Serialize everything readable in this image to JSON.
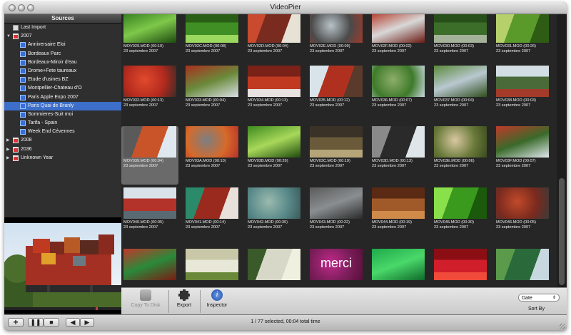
{
  "window": {
    "title": "VideoPier"
  },
  "sidebar": {
    "header": "Sources",
    "items": [
      {
        "label": "Last Import",
        "level": 0,
        "icon": "import-icon",
        "disclosure": ""
      },
      {
        "label": "2007",
        "level": 0,
        "icon": "calendar-folder-icon",
        "disclosure": "▼"
      },
      {
        "label": "Anniversaire Eloi",
        "level": 1,
        "icon": "film-icon",
        "disclosure": ""
      },
      {
        "label": "Bordeaux Parc",
        "level": 1,
        "icon": "film-icon",
        "disclosure": ""
      },
      {
        "label": "Bordeaux-Miroir d'eau",
        "level": 1,
        "icon": "film-icon",
        "disclosure": ""
      },
      {
        "label": "Drome+Fete taureaux",
        "level": 1,
        "icon": "film-icon",
        "disclosure": ""
      },
      {
        "label": "Etude d'usines BZ",
        "level": 1,
        "icon": "film-icon",
        "disclosure": ""
      },
      {
        "label": "Montpellier-Chateau d'O",
        "level": 1,
        "icon": "film-icon",
        "disclosure": ""
      },
      {
        "label": "Paris Apple Expo 2007",
        "level": 1,
        "icon": "film-icon",
        "disclosure": ""
      },
      {
        "label": "Paris Quai de Branly",
        "level": 1,
        "icon": "film-icon",
        "disclosure": "",
        "selected": true
      },
      {
        "label": "Sommieres-Suit moi",
        "level": 1,
        "icon": "film-icon",
        "disclosure": ""
      },
      {
        "label": "Tarifa - Spain",
        "level": 1,
        "icon": "film-icon",
        "disclosure": ""
      },
      {
        "label": "Week End Cévennes",
        "level": 1,
        "icon": "film-icon",
        "disclosure": ""
      },
      {
        "label": "2008",
        "level": 0,
        "icon": "calendar-folder-icon",
        "disclosure": "▶"
      },
      {
        "label": "2036",
        "level": 0,
        "icon": "calendar-folder-icon",
        "disclosure": "▶"
      },
      {
        "label": "Unknown Year",
        "level": 0,
        "icon": "calendar-folder-icon",
        "disclosure": "▶"
      }
    ]
  },
  "clips": [
    {
      "name": "MOV029.MOD (00:10)",
      "date": "23 septembre 2007",
      "palette": [
        "#2f7a1c",
        "#7ec84a",
        "#1d4a10"
      ]
    },
    {
      "name": "MOV02C.MOD (00:08)",
      "date": "23 septembre 2007",
      "palette": [
        "#3f8f24",
        "#9ad85e",
        "#2a5d16"
      ]
    },
    {
      "name": "MOV02D.MOD (00:04)",
      "date": "23 septembre 2007",
      "palette": [
        "#7a2b20",
        "#c94a2e",
        "#e8e2d6"
      ]
    },
    {
      "name": "MOV02E.MOD (00:09)",
      "date": "23 septembre 2007",
      "palette": [
        "#4a4a4a",
        "#b8c3c8",
        "#9e3a2a"
      ]
    },
    {
      "name": "MOV02F.MOD (00:02)",
      "date": "23 septembre 2007",
      "palette": [
        "#b3321f",
        "#d8d8d8",
        "#6b1a12"
      ]
    },
    {
      "name": "MOV030.MOD (00:03)",
      "date": "23 septembre 2007",
      "palette": [
        "#3c6e2a",
        "#a5b29a",
        "#274f1a"
      ]
    },
    {
      "name": "MOV031.MOD (00:26)",
      "date": "23 septembre 2007",
      "palette": [
        "#5a9a2a",
        "#b6d16c",
        "#2e5c14"
      ]
    },
    {
      "name": "MOV032.MOD (00:13)",
      "date": "23 septembre 2007",
      "palette": [
        "#b32a1e",
        "#e24a2c",
        "#3a2b25"
      ]
    },
    {
      "name": "MOV033.MOD (00:04)",
      "date": "23 septembre 2007",
      "palette": [
        "#a8301e",
        "#6a8a3a",
        "#d9dfe6"
      ]
    },
    {
      "name": "MOV034.MOD (00:13)",
      "date": "23 septembre 2007",
      "palette": [
        "#c03a22",
        "#e8e2e0",
        "#7a2218"
      ]
    },
    {
      "name": "MOV035.MOD (00:12)",
      "date": "23 septembre 2007",
      "palette": [
        "#b0301f",
        "#d9e4ea",
        "#5a3a2a"
      ]
    },
    {
      "name": "MOV036.MOD (00:07)",
      "date": "23 septembre 2007",
      "palette": [
        "#3e7a2a",
        "#8eae6a",
        "#c8d8e0"
      ]
    },
    {
      "name": "MOV037.MOD (00:04)",
      "date": "23 septembre 2007",
      "palette": [
        "#5b8a3a",
        "#b9c8d0",
        "#2f4e1c"
      ]
    },
    {
      "name": "MOV038.MOD (00:03)",
      "date": "23 septembre 2007",
      "palette": [
        "#4b6a3a",
        "#a33a2a",
        "#d2dde4"
      ]
    },
    {
      "name": "MOV039.MOD (00:04)",
      "date": "23 septembre 2007",
      "palette": [
        "#c9542a",
        "#5a5a5a",
        "#dfe8ee"
      ]
    },
    {
      "name": "MOV03A.MOD (00:10)",
      "date": "23 septembre 2007",
      "palette": [
        "#d66a2a",
        "#7b7f82",
        "#b8322a"
      ]
    },
    {
      "name": "MOV03B.MOD (00:26)",
      "date": "23 septembre 2007",
      "palette": [
        "#3d8a1e",
        "#a8d85a",
        "#1e4a0e"
      ]
    },
    {
      "name": "MOV03C.MOD (00:19)",
      "date": "23 septembre 2007",
      "palette": [
        "#6a5a3a",
        "#b7a57a",
        "#3a3226"
      ]
    },
    {
      "name": "MOV03D.MOD (00:13)",
      "date": "23 septembre 2007",
      "palette": [
        "#2a2a2a",
        "#8a8a8a",
        "#dfe6ea"
      ]
    },
    {
      "name": "MOV03E.MOD (00:06)",
      "date": "23 septembre 2007",
      "palette": [
        "#6a7a3a",
        "#d8c8a0",
        "#3a4a1e"
      ]
    },
    {
      "name": "MOV03F.MOD (00:07)",
      "date": "23 septembre 2007",
      "palette": [
        "#c0392b",
        "#3a6a2a",
        "#e0e8ee"
      ]
    },
    {
      "name": "MOV040.MOD (00:05)",
      "date": "23 septembre 2007",
      "palette": [
        "#b3322a",
        "#5a6a72",
        "#d8e2e8"
      ]
    },
    {
      "name": "MOV041.MOD (00:14)",
      "date": "23 septembre 2007",
      "palette": [
        "#9a2a1e",
        "#2a8a6a",
        "#e8e0da"
      ]
    },
    {
      "name": "MOV042.MOD (00:30)",
      "date": "23 septembre 2007",
      "palette": [
        "#5a8a8a",
        "#9abaae",
        "#3a5a5a"
      ]
    },
    {
      "name": "MOV043.MOD (00:22)",
      "date": "23 septembre 2007",
      "palette": [
        "#5a5a5a",
        "#8a8e90",
        "#2a2a2a"
      ]
    },
    {
      "name": "MOV044.MOD (00:19)",
      "date": "23 septembre 2007",
      "palette": [
        "#a05a2a",
        "#d08a4a",
        "#5a2a14"
      ]
    },
    {
      "name": "MOV045.MOD (00:30)",
      "date": "23 septembre 2007",
      "palette": [
        "#3a9a1e",
        "#8ae04a",
        "#1a5a0a"
      ]
    },
    {
      "name": "MOV046.MOD (00:05)",
      "date": "23 septembre 2007",
      "palette": [
        "#7a2a1e",
        "#c04a2a",
        "#3a3a3a"
      ]
    },
    {
      "name": "",
      "date": "",
      "palette": [
        "#c0392b",
        "#2a8a3a",
        "#7a1a14"
      ]
    },
    {
      "name": "",
      "date": "",
      "palette": [
        "#e8e8d8",
        "#6a8a3a",
        "#c8c8a8"
      ]
    },
    {
      "name": "",
      "date": "",
      "palette": [
        "#d8d8c8",
        "#3a5a2a",
        "#f0f0e0"
      ]
    },
    {
      "name": "",
      "date": "",
      "palette": [
        "#7a1e5a",
        "#c02a8a",
        "#5a0e3a"
      ],
      "text": "merci"
    },
    {
      "name": "",
      "date": "",
      "palette": [
        "#1eaa4a",
        "#4ad86a",
        "#0e6a2a"
      ]
    },
    {
      "name": "",
      "date": "",
      "palette": [
        "#d01e2a",
        "#f04a3a",
        "#8a0e14"
      ]
    },
    {
      "name": "",
      "date": "",
      "palette": [
        "#2a6a3a",
        "#5a9a4a",
        "#c8d8e0"
      ]
    }
  ],
  "selected_index": 14,
  "toolbar": {
    "copy_label": "Copy To Disk",
    "export_label": "Export",
    "inspector_label": "Inspector",
    "sort_value": "Date",
    "sort_label": "Sort By"
  },
  "statusbar": {
    "text": "1 / 77 selected, 00:04 total time",
    "add_label": "+"
  }
}
